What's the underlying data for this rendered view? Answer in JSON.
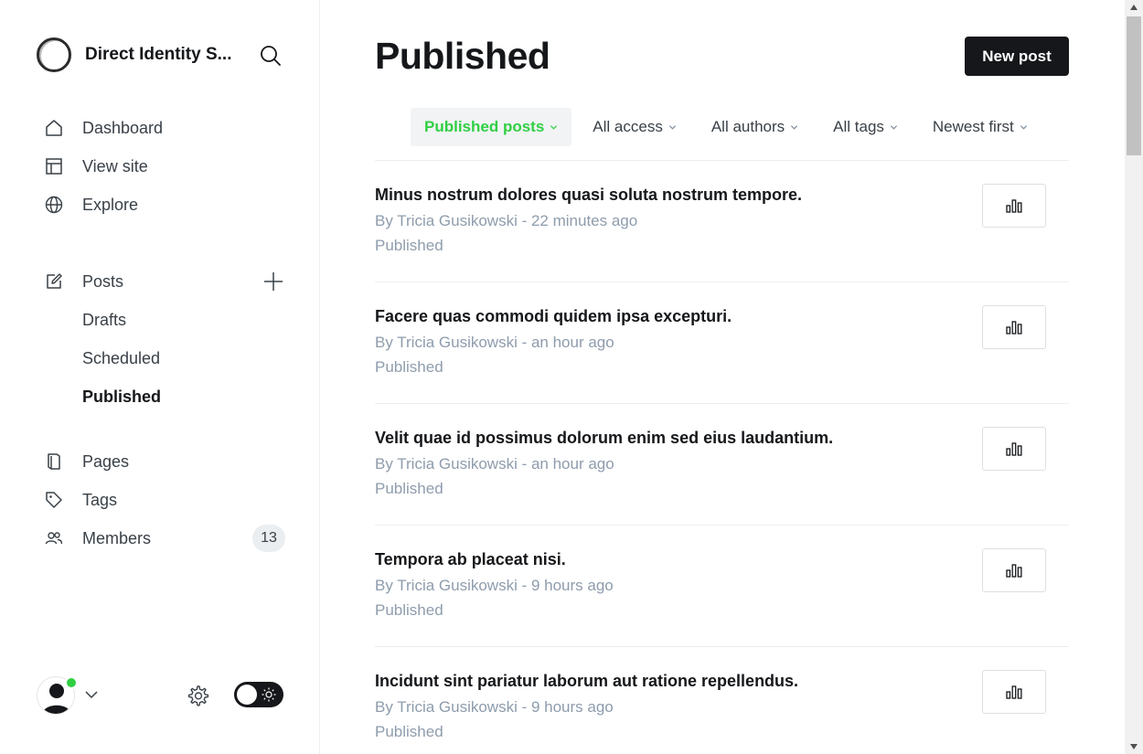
{
  "sidebar": {
    "brand_title": "Direct Identity S...",
    "nav_primary": [
      {
        "label": "Dashboard",
        "icon": "home-icon"
      },
      {
        "label": "View site",
        "icon": "layout-icon"
      },
      {
        "label": "Explore",
        "icon": "globe-icon"
      }
    ],
    "posts": {
      "label": "Posts",
      "icon": "edit-icon",
      "sub": [
        {
          "label": "Drafts",
          "active": false
        },
        {
          "label": "Scheduled",
          "active": false
        },
        {
          "label": "Published",
          "active": true
        }
      ]
    },
    "nav_secondary": [
      {
        "label": "Pages",
        "icon": "page-icon"
      },
      {
        "label": "Tags",
        "icon": "tag-icon"
      },
      {
        "label": "Members",
        "icon": "members-icon",
        "count": "13"
      }
    ],
    "footer": {
      "avatar_icon": "user-avatar-icon",
      "status_color": "#30cf43",
      "settings_icon": "gear-icon",
      "theme_toggle_icon": "sun-icon"
    }
  },
  "main": {
    "title": "Published",
    "new_post_label": "New post",
    "filters": [
      {
        "label": "Published posts",
        "active": true
      },
      {
        "label": "All access",
        "active": false
      },
      {
        "label": "All authors",
        "active": false
      },
      {
        "label": "All tags",
        "active": false
      },
      {
        "label": "Newest first",
        "active": false
      }
    ],
    "posts": [
      {
        "title": "Minus nostrum dolores quasi soluta nostrum tempore.",
        "meta": "By Tricia Gusikowski - 22 minutes ago",
        "status": "Published"
      },
      {
        "title": "Facere quas commodi quidem ipsa excepturi.",
        "meta": "By Tricia Gusikowski - an hour ago",
        "status": "Published"
      },
      {
        "title": "Velit quae id possimus dolorum enim sed eius laudantium.",
        "meta": "By Tricia Gusikowski - an hour ago",
        "status": "Published"
      },
      {
        "title": "Tempora ab placeat nisi.",
        "meta": "By Tricia Gusikowski - 9 hours ago",
        "status": "Published"
      },
      {
        "title": "Incidunt sint pariatur laborum aut ratione repellendus.",
        "meta": "By Tricia Gusikowski - 9 hours ago",
        "status": "Published"
      }
    ]
  },
  "colors": {
    "accent_green": "#30cf43",
    "text_dark": "#15171a",
    "text_muted": "#8e9cac",
    "border": "#ebeef0"
  }
}
